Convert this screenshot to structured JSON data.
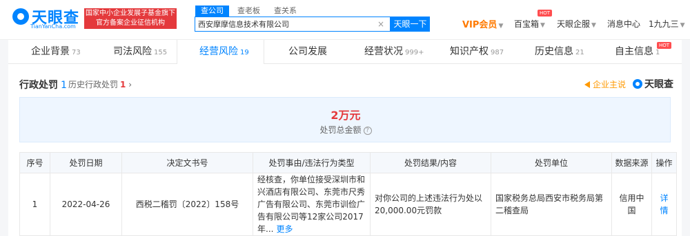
{
  "header": {
    "logo_text": "天眼查",
    "logo_domain": "TianYanCha.com",
    "gov_badge_line1": "国家中小企业发展子基金旗下",
    "gov_badge_line2": "官方备案企业征信机构",
    "search_tabs": [
      "查公司",
      "查老板",
      "查关系"
    ],
    "search_value": "西安摩摩信息技术有限公司",
    "search_button": "天眼一下",
    "nav_vip": "VIP会员",
    "nav_baibao": "百宝箱",
    "nav_qiban": "天眼企服",
    "nav_msg": "消息中心",
    "nav_user": "1九九三",
    "hot_label": "HOT"
  },
  "tabs": [
    {
      "label": "企业背景",
      "count": "73"
    },
    {
      "label": "司法风险",
      "count": "155"
    },
    {
      "label": "经营风险",
      "count": "19"
    },
    {
      "label": "公司发展",
      "count": ""
    },
    {
      "label": "经营状况",
      "count": "999+"
    },
    {
      "label": "知识产权",
      "count": "987"
    },
    {
      "label": "历史信息",
      "count": "21"
    },
    {
      "label": "自主信息",
      "count": "1"
    }
  ],
  "section": {
    "title": "行政处罚",
    "count": "1",
    "history_label": "历史行政处罚",
    "history_count": "1",
    "history_arrow": "›",
    "brand_link": "企业主说",
    "brand_logo": "天眼查"
  },
  "summary": {
    "amount": "2万元",
    "label": "处罚总金额",
    "help": "?"
  },
  "table": {
    "headers": [
      "序号",
      "处罚日期",
      "决定文书号",
      "处罚事由/违法行为类型",
      "处罚结果/内容",
      "处罚单位",
      "数据来源",
      "操作"
    ],
    "rows": [
      {
        "index": "1",
        "date": "2022-04-26",
        "doc_no": "西税二稽罚〔2022〕158号",
        "reason": "经核查，你单位接受深圳市和兴酒店有限公司、东莞市尺秀广告有限公司、东莞市训俭广告有限公司等12家公司2017年...",
        "more": "更多",
        "result": "对你公司的上述违法行为处以20,000.00元罚款",
        "unit": "国家税务总局西安市税务局第二稽查局",
        "source": "信用中国",
        "action": "详情"
      }
    ]
  }
}
